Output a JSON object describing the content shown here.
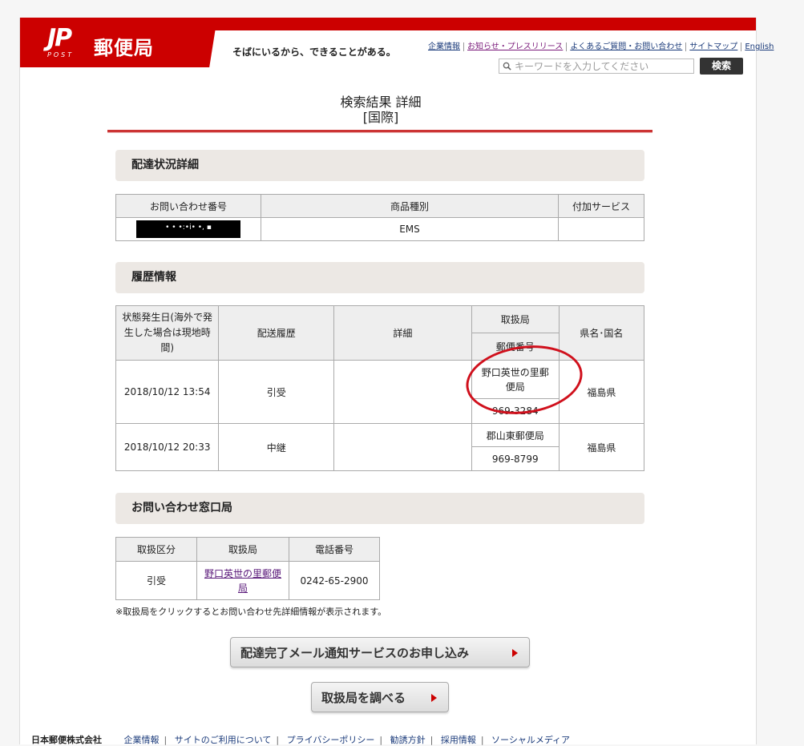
{
  "header": {
    "logo_jp": "JP",
    "logo_post": "POST",
    "logo_name": "郵便局",
    "tagline": "そばにいるから、できることがある。",
    "links": [
      "企業情報",
      "お知らせ・プレスリリース",
      "よくあるご質問・お問い合わせ",
      "サイトマップ",
      "English"
    ],
    "search_placeholder": "キーワードを入力してください",
    "search_button": "検索"
  },
  "title": {
    "line1": "検索結果 詳細",
    "line2": "[国際]"
  },
  "delivery": {
    "heading": "配達状況詳細",
    "headers": [
      "お問い合わせ番号",
      "商品種別",
      "付加サービス"
    ],
    "tracking_mask": "• • •:•i• •,     ▪",
    "product_type": "EMS",
    "additional_service": ""
  },
  "history": {
    "heading": "履歴情報",
    "headers": {
      "date": "状態発生日(海外で発生した場合は現地時間)",
      "status": "配送履歴",
      "detail": "詳細",
      "office": "取扱局",
      "postal": "郵便番号",
      "region": "県名･国名"
    },
    "rows": [
      {
        "date": "2018/10/12 13:54",
        "status": "引受",
        "detail": "",
        "office": "野口英世の里郵便局",
        "postal": "969-3284",
        "region": "福島県"
      },
      {
        "date": "2018/10/12 20:33",
        "status": "中継",
        "detail": "",
        "office": "郡山東郵便局",
        "postal": "969-8799",
        "region": "福島県"
      }
    ]
  },
  "contact": {
    "heading": "お問い合わせ窓口局",
    "headers": [
      "取扱区分",
      "取扱局",
      "電話番号"
    ],
    "row": {
      "category": "引受",
      "office": "野口英世の里郵便局",
      "phone": "0242-65-2900"
    },
    "note": "※取扱局をクリックするとお問い合わせ先詳細情報が表示されます。"
  },
  "buttons": {
    "mail_notice": "配達完了メール通知サービスのお申し込み",
    "find_office": "取扱局を調べる"
  },
  "footer": {
    "company": "日本郵便株式会社",
    "links": [
      "企業情報",
      "サイトのご利用について",
      "プライバシーポリシー",
      "勧誘方針",
      "採用情報",
      "ソーシャルメディア"
    ]
  },
  "colors": {
    "brand": "#cc0000",
    "annotation": "#d0101c"
  }
}
